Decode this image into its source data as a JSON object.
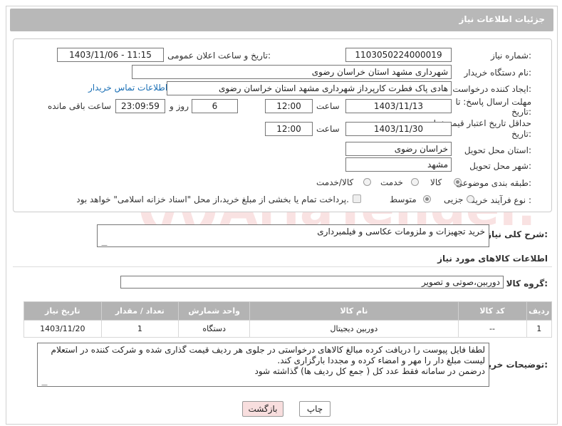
{
  "page": {
    "title": "جزئیات اطلاعات نیاز"
  },
  "form": {
    "need_number_label": "شماره نیاز:",
    "need_number": "1103050224000019",
    "announce_label": "تاریخ و ساعت اعلان عمومی:",
    "announce_value": "1403/11/06 - 11:15",
    "buyer_org_label": "نام دستگاه خریدار:",
    "buyer_org": "شهرداری مشهد استان خراسان رضوی",
    "creator_label": "ایجاد کننده درخواست:",
    "creator": "هادی پاک فطرت کارپرداز شهرداری مشهد استان خراسان رضوی",
    "contact_link": "اطلاعات تماس خریدار",
    "deadline_label": "مهلت ارسال پاسخ: تا تاریخ:",
    "deadline_date": "1403/11/13",
    "time_label": "ساعت",
    "deadline_time": "12:00",
    "days": "6",
    "days_word": "روز و",
    "remaining": "23:09:59",
    "remaining_word": "ساعت باقی مانده",
    "min_price_label": "حداقل تاریخ اعتبار قیمت: تا تاریخ:",
    "min_price_date": "1403/11/30",
    "min_price_time": "12:00",
    "province_label": "استان محل تحویل:",
    "province": "خراسان رضوی",
    "city_label": "شهر محل تحویل:",
    "city": "مشهد",
    "category_label": "طبقه بندی موضوعی:",
    "category_options": [
      "کالا",
      "خدمت",
      "کالا/خدمت"
    ],
    "process_label": "نوع فرآیند خرید :",
    "process_options": [
      "جزیی",
      "متوسط"
    ],
    "payment_note": "پرداخت تمام یا بخشی از مبلغ خرید،از محل \"اسناد خزانه اسلامی\" خواهد بود."
  },
  "summary": {
    "label": "شرح کلی نیاز:",
    "value": "خرید تجهیزات و ملزومات عکاسی و فیلمبرداری"
  },
  "items_section": {
    "title": "اطلاعات کالاهای مورد نیاز",
    "group_label": "گروه کالا:",
    "group_value": "دوربین،صوتی و تصویر"
  },
  "table": {
    "headers": [
      "ردیف",
      "کد کالا",
      "نام کالا",
      "واحد شمارش",
      "تعداد / مقدار",
      "تاریخ نیاز"
    ],
    "rows": [
      [
        "1",
        "--",
        "دوربین دیجیتال",
        "دستگاه",
        "1",
        "1403/11/20"
      ]
    ]
  },
  "buyer_notes": {
    "label": "توضیحات خریدار:",
    "lines": [
      "لطفا فایل پیوست را دریافت کرده مبالغ کالاهای درخواستی در جلوی هر ردیف قیمت گذاری شده و شرکت کننده در استعلام",
      "لیست مبلغ دار را مهر و امضاء کرده و مجددا بارگزاری کند.",
      "درضمن در سامانه فقط عدد کل ( جمع کل ردیف ها) گذاشته شود"
    ]
  },
  "buttons": {
    "print": "چاپ",
    "back": "بازگشت"
  },
  "watermark": {
    "text": "AriaTender.net"
  },
  "colors": {
    "title_bar": "#b8b8b8",
    "link": "#1a6fb5",
    "back_button": "#f8dede"
  }
}
